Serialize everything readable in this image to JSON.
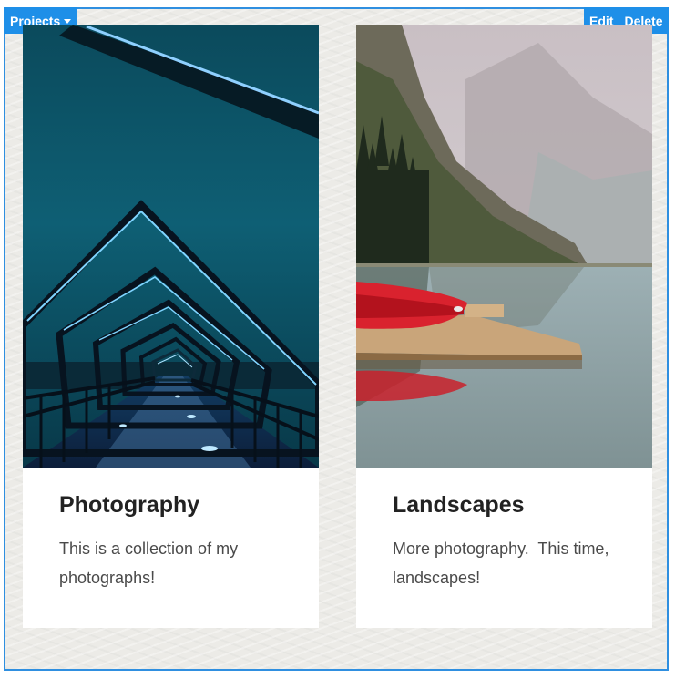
{
  "toolbar": {
    "projects_label": "Projects",
    "edit_label": "Edit",
    "delete_label": "Delete",
    "accent_color": "#1e8fe8"
  },
  "cards": [
    {
      "title": "Photography",
      "description": "This is a collection of my photographs!",
      "image": "bridge-tunnel-photo"
    },
    {
      "title": "Landscapes",
      "description": "More photography.  This time, landscapes!",
      "image": "mountain-lake-photo"
    }
  ]
}
